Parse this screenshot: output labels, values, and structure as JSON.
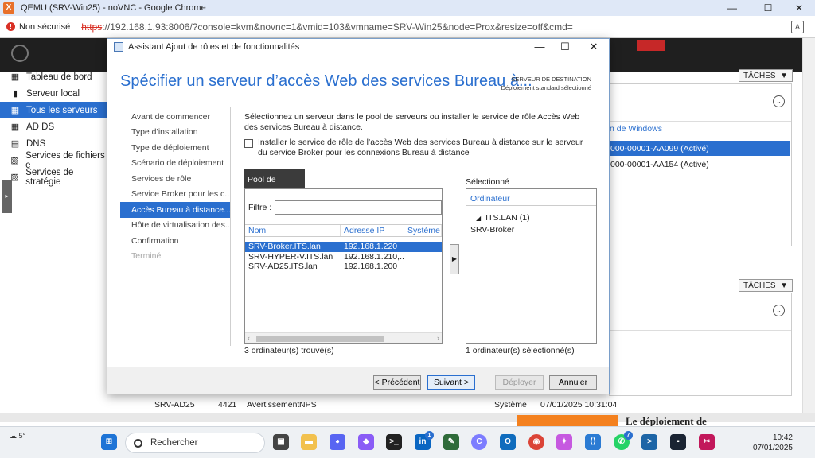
{
  "browser": {
    "title": "QEMU (SRV-Win25) - noVNC - Google Chrome",
    "security_label": "Non sécurisé",
    "url_scheme": "https",
    "url_rest": "://192.168.1.93:8006/?console=kvm&novnc=1&vmid=103&vmname=SRV-Win25&node=Prox&resize=off&cmd="
  },
  "server_manager": {
    "nav": [
      "Tableau de bord",
      "Serveur local",
      "Tous les serveurs",
      "AD DS",
      "DNS",
      "Services de fichiers e",
      "Services de stratégie"
    ],
    "nav_selected_index": 2,
    "tasks_label": "TÂCHES",
    "col_activation": "n de Windows",
    "rows": [
      "000-00001-AA099 (Activé)",
      "000-00001-AA154 (Activé)"
    ],
    "event_row": {
      "server": "SRV-AD25",
      "id": "4421",
      "level": "Avertissement",
      "source": "NPS",
      "log": "Système",
      "date": "07/01/2025 10:31:04"
    },
    "banner_text": "Le déploiement de"
  },
  "dialog": {
    "title": "Assistant Ajout de rôles et de fonctionnalités",
    "heading": "Spécifier un serveur d’accès Web des services Bureau à...",
    "dest_title": "SERVEUR DE DESTINATION",
    "dest_value": "Déploiement standard sélectionné",
    "steps": [
      {
        "label": "Avant de commencer",
        "state": "normal"
      },
      {
        "label": "Type d’installation",
        "state": "normal"
      },
      {
        "label": "Type de déploiement",
        "state": "normal"
      },
      {
        "label": "Scénario de déploiement",
        "state": "normal"
      },
      {
        "label": "Services de rôle",
        "state": "normal"
      },
      {
        "label": "Service Broker pour les c...",
        "state": "normal"
      },
      {
        "label": "Accès Bureau à distance...",
        "state": "selected"
      },
      {
        "label": "Hôte de virtualisation des...",
        "state": "normal"
      },
      {
        "label": "Confirmation",
        "state": "normal"
      },
      {
        "label": "Terminé",
        "state": "disabled"
      }
    ],
    "description": "Sélectionnez un serveur dans le pool de serveurs ou installer le service de rôle Accès Web des services Bureau à distance.",
    "checkbox_label": "Installer le service de rôle de l’accès Web des services Bureau à distance sur le serveur du service Broker pour les connexions Bureau à distance",
    "checkbox_checked": false,
    "pool": {
      "tab_label": "Pool de serveurs",
      "filter_label": "Filtre :",
      "filter_value": "",
      "columns": [
        "Nom",
        "Adresse IP",
        "Système d"
      ],
      "rows": [
        {
          "name": "SRV-Broker.ITS.lan",
          "ip": "192.168.1.220",
          "os": ""
        },
        {
          "name": "SRV-HYPER-V.ITS.lan",
          "ip": "192.168.1.210,...",
          "os": ""
        },
        {
          "name": "SRV-AD25.ITS.lan",
          "ip": "192.168.1.200",
          "os": ""
        }
      ],
      "selected_index": 0,
      "found_text": "3 ordinateur(s) trouvé(s)"
    },
    "selected_panel": {
      "label": "Sélectionné",
      "column": "Ordinateur",
      "group": "ITS.LAN (1)",
      "items": [
        "SRV-Broker"
      ],
      "count_text": "1 ordinateur(s) sélectionné(s)"
    },
    "buttons": {
      "prev": "< Précédent",
      "next": "Suivant >",
      "deploy": "Déployer",
      "cancel": "Annuler"
    }
  },
  "taskbar": {
    "weather": "5°",
    "search_placeholder": "Rechercher",
    "time": "10:42",
    "date": "07/01/2025",
    "badges": {
      "linkedin": "1",
      "whatsapp": "7"
    }
  },
  "colors": {
    "accent": "#2a6fcf",
    "heading": "#2a6fcf",
    "selection": "#2a6fcf"
  }
}
